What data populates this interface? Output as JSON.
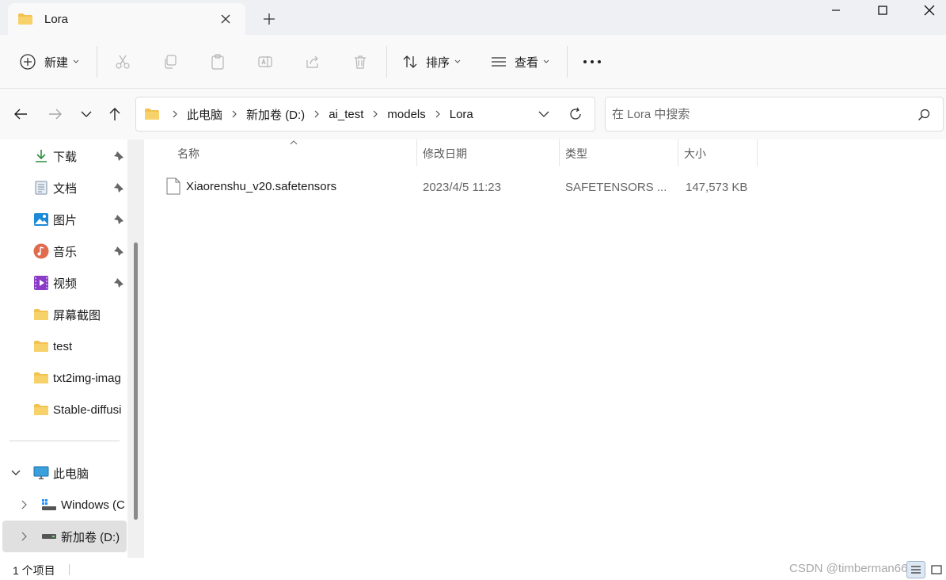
{
  "window": {
    "tab_title": "Lora",
    "new_tab_label": "+"
  },
  "toolbar": {
    "new_label": "新建",
    "sort_label": "排序",
    "view_label": "查看",
    "more_label": "•••"
  },
  "address": {
    "crumbs": [
      "此电脑",
      "新加卷 (D:)",
      "ai_test",
      "models",
      "Lora"
    ]
  },
  "search": {
    "placeholder": "在 Lora 中搜索"
  },
  "sidebar": {
    "quick_access": [
      {
        "label": "下载",
        "icon": "download-icon",
        "pinned": true
      },
      {
        "label": "文档",
        "icon": "document-icon",
        "pinned": true
      },
      {
        "label": "图片",
        "icon": "pictures-icon",
        "pinned": true
      },
      {
        "label": "音乐",
        "icon": "music-icon",
        "pinned": true
      },
      {
        "label": "视频",
        "icon": "video-icon",
        "pinned": true
      },
      {
        "label": "屏幕截图",
        "icon": "folder-icon",
        "pinned": false
      },
      {
        "label": "test",
        "icon": "folder-icon",
        "pinned": false
      },
      {
        "label": "txt2img-imag",
        "icon": "folder-icon",
        "pinned": false
      },
      {
        "label": "Stable-diffusi",
        "icon": "folder-icon",
        "pinned": false
      }
    ],
    "this_pc": {
      "label": "此电脑",
      "icon": "computer-icon"
    },
    "drives": [
      {
        "label": "Windows (C",
        "icon": "windows-drive-icon"
      },
      {
        "label": "新加卷 (D:)",
        "icon": "drive-icon",
        "selected": true
      }
    ]
  },
  "list": {
    "columns": [
      "名称",
      "修改日期",
      "类型",
      "大小"
    ],
    "files": [
      {
        "name": "Xiaorenshu_v20.safetensors",
        "modified": "2023/4/5 11:23",
        "type": "SAFETENSORS ...",
        "size": "147,573 KB"
      }
    ]
  },
  "status": {
    "item_count": "1 个项目",
    "watermark": "CSDN @timberman666"
  },
  "colors": {
    "folder": "#f2c14e",
    "accent": "#0067c0",
    "selection": "#e0e0e0"
  }
}
